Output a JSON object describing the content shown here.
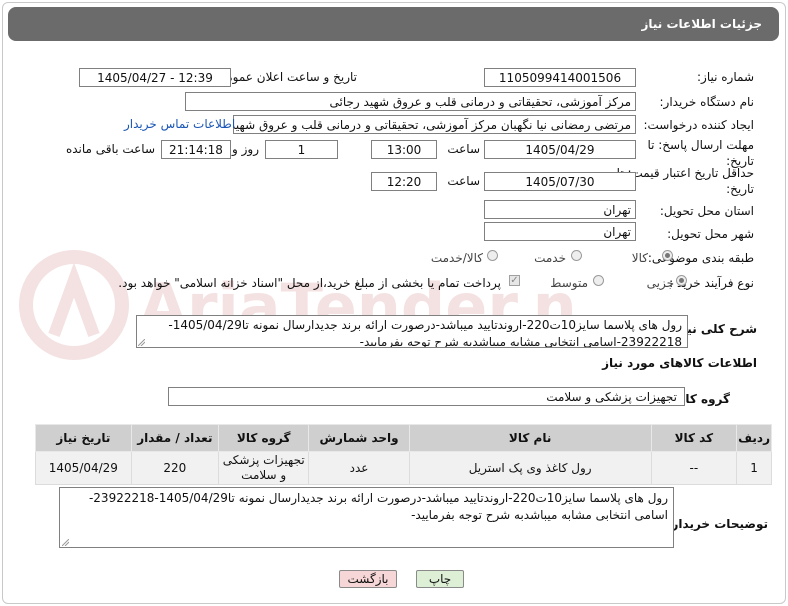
{
  "header": {
    "title": "جزئیات اطلاعات نیاز"
  },
  "form": {
    "need_number_label": "شماره نیاز:",
    "need_number": "1105099414001506",
    "announce_label": "تاریخ و ساعت اعلان عمومی:",
    "announce_value": "1405/04/27 - 12:39",
    "buyer_org_label": "نام دستگاه خریدار:",
    "buyer_org": "مرکز آموزشی، تحقیقاتی و درمانی قلب و عروق شهید رجائی",
    "creator_label": "ایجاد کننده درخواست:",
    "creator": "مرتضی رمضانی نیا نگهبان مرکز آموزشی، تحقیقاتی و درمانی قلب و عروق شهید رجائی",
    "contact_link": "اطلاعات تماس خریدار",
    "reply_deadline_label": "مهلت ارسال پاسخ: تا تاریخ:",
    "reply_date": "1405/04/29",
    "time_label": "ساعت",
    "reply_time": "13:00",
    "days_value": "1",
    "days_label": "روز و",
    "remaining_value": "21:14:18",
    "remaining_label": "ساعت باقی مانده",
    "price_validity_label": "حداقل تاریخ اعتبار قیمت: تا تاریخ:",
    "price_date": "1405/07/30",
    "price_time": "12:20",
    "province_label": "استان محل تحویل:",
    "province": "تهران",
    "city_label": "شهر محل تحویل:",
    "city": "تهران",
    "category_label": "طبقه بندی موضوعی:",
    "category_options": [
      "کالا",
      "خدمت",
      "کالا/خدمت"
    ],
    "category_selected": "کالا",
    "process_label": "نوع فرآیند خرید :",
    "process_options": [
      "جزیی",
      "متوسط"
    ],
    "process_selected": "جزیی",
    "payment_note": "پرداخت تمام یا بخشی از مبلغ خرید،از محل \"اسناد خزانه اسلامی\" خواهد بود.",
    "general_desc_label": "شرح کلی نیاز:",
    "general_desc": "رول های  پلاسما سایز10ت220-اروندتایید میباشد-درصورت ارائه برند جدیدارسال نمونه تا1405/04/29-23922218-اسامی  انتخابی مشابه میباشدبه شرح توجه بفرمایید-",
    "goods_info_title": "اطلاعات کالاهای مورد نیاز",
    "goods_group_label": "گروه کالا:",
    "goods_group": "تجهیزات پزشکی و سلامت"
  },
  "table": {
    "headers": [
      "ردیف",
      "کد کالا",
      "نام کالا",
      "واحد شمارش",
      "گروه کالا",
      "تعداد / مقدار",
      "تاریخ نیاز"
    ],
    "rows": [
      [
        "1",
        "--",
        "رول کاغذ وی پک استریل",
        "عدد",
        "تجهیزات پزشکی و سلامت",
        "220",
        "1405/04/29"
      ]
    ]
  },
  "buyer_notes": {
    "label": "توضیحات خریدار:",
    "text": "رول های  پلاسما سایز10ت220-اروندتایید میباشد-درصورت ارائه برند جدیدارسال نمونه تا1405/04/29-23922218-اسامی انتخابی مشابه میباشدبه شرح توجه بفرمایید-"
  },
  "buttons": {
    "print": "چاپ",
    "back": "بازگشت"
  },
  "watermark": {
    "text": "AriaTender.net"
  },
  "colors": {
    "titlebar": "#6b6b6b",
    "link": "#1a56b5",
    "back_button": "#f6d6d6",
    "print_button": "#ddf0d6"
  }
}
